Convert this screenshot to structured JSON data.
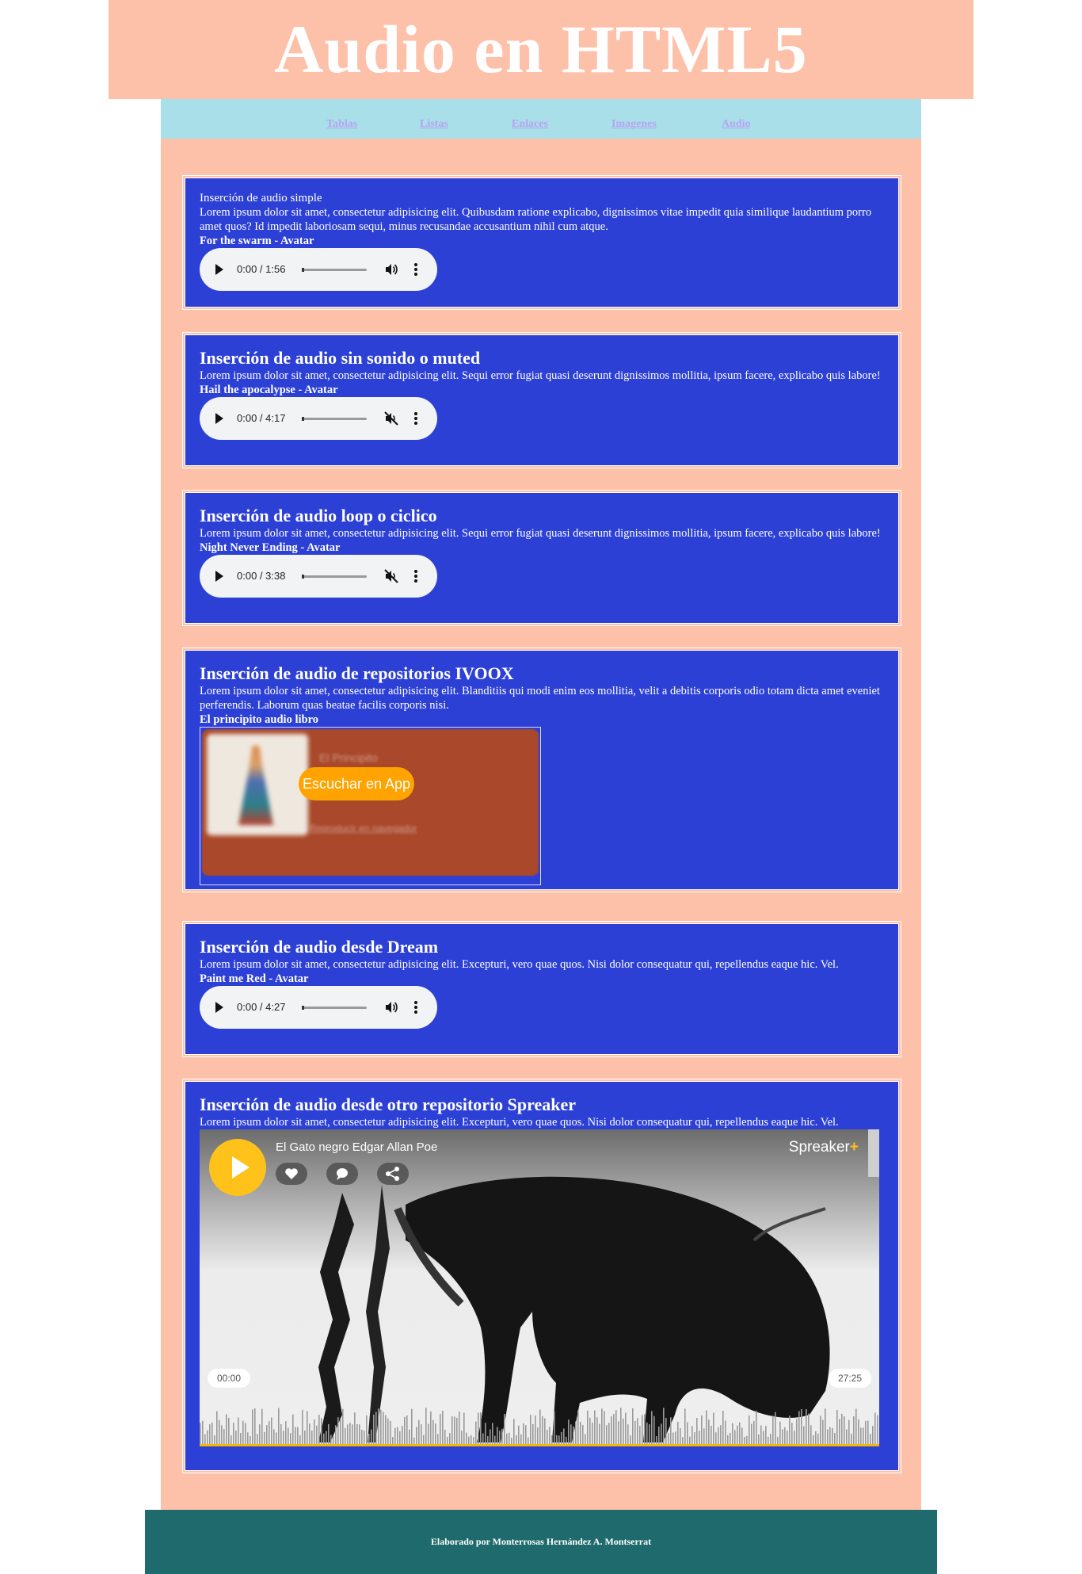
{
  "header": {
    "title": "Audio en HTML5"
  },
  "nav": [
    "Tablas",
    "Listas",
    "Enlaces",
    "Imagenes",
    "Audio"
  ],
  "sections": [
    {
      "title": "Inserción de audio simple",
      "text": "Lorem ipsum dolor sit amet, consectetur adipisicing elit. Quibusdam ratione explicabo, dignissimos vitae impedit quia similique laudantium porro amet quos? Id impedit laboriosam sequi, minus recusandae accusantium nihil cum atque.",
      "song": "For the swarm - Avatar",
      "player": {
        "time": "0:00 / 1:56",
        "muted": false
      }
    },
    {
      "title": "Inserción de audio sin sonido o muted",
      "text": "Lorem ipsum dolor sit amet, consectetur adipisicing elit. Sequi error fugiat quasi deserunt dignissimos mollitia, ipsum facere, explicabo quis labore!",
      "song": "Hail the apocalypse - Avatar",
      "player": {
        "time": "0:00 / 4:17",
        "muted": true
      }
    },
    {
      "title": "Inserción de audio loop o ciclico",
      "text": "Lorem ipsum dolor sit amet, consectetur adipisicing elit. Sequi error fugiat quasi deserunt dignissimos mollitia, ipsum facere, explicabo quis labore!",
      "song": "Night Never Ending - Avatar",
      "player": {
        "time": "0:00 / 3:38",
        "muted": true
      }
    },
    {
      "title": "Inserción de audio de repositorios IVOOX",
      "text": "Lorem ipsum dolor sit amet, consectetur adipisicing elit. Blanditiis qui modi enim eos mollitia, velit a debitis corporis odio totam dicta amet eveniet perferendis. Laborum quas beatae facilis corporis nisi.",
      "song": "El principito audio libro",
      "embed": {
        "button": "Escuchar en App",
        "episode": "El Principito",
        "browser": "Reproducir en navegador"
      }
    },
    {
      "title": "Inserción de audio desde Dream",
      "text": "Lorem ipsum dolor sit amet, consectetur adipisicing elit. Excepturi, vero quae quos. Nisi dolor consequatur qui, repellendus eaque hic. Vel.",
      "song": "Paint me Red - Avatar",
      "player": {
        "time": "0:00 / 4:27",
        "muted": false
      }
    },
    {
      "title": "Inserción de audio desde otro repositorio Spreaker",
      "text": "Lorem ipsum dolor sit amet, consectetur adipisicing elit. Excepturi, vero quae quos. Nisi dolor consequatur qui, repellendus eaque hic. Vel.",
      "embed": {
        "episode": "El Gato negro Edgar Allan Poe",
        "brand": "Spreaker",
        "start": "00:00",
        "end": "27:25"
      }
    }
  ],
  "footer": {
    "credit": "Elaborado por Monterrosas Hernández A. Montserrat"
  },
  "colors": {
    "page": "#fdc1aa",
    "nav": "#a9dfe8",
    "card": "#2c40d6",
    "footer": "#1f6a6d",
    "accent": "#ffa300"
  }
}
